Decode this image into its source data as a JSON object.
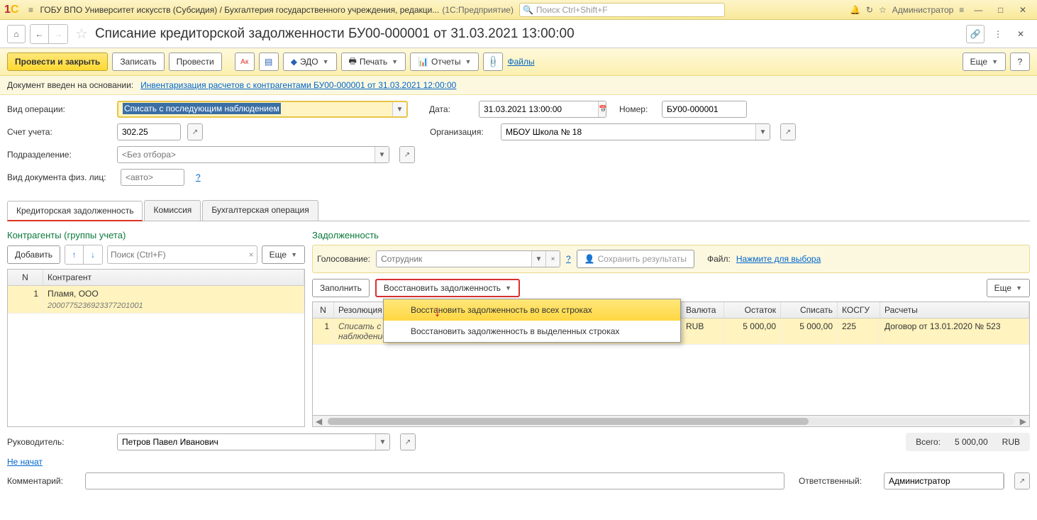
{
  "titlebar": {
    "text": "ГОБУ ВПО Университет искусств (Субсидия) / Бухгалтерия государственного учреждения, редакци...",
    "app": "(1С:Предприятие)",
    "search_placeholder": "Поиск Ctrl+Shift+F",
    "user": "Администратор"
  },
  "header": {
    "title": "Списание кредиторской задолженности БУ00-000001 от 31.03.2021 13:00:00"
  },
  "toolbar": {
    "provesti_zakryt": "Провести и закрыть",
    "zapisat": "Записать",
    "provesti": "Провести",
    "edo": "ЭДО",
    "pechat": "Печать",
    "otchety": "Отчеты",
    "files": "Файлы",
    "more": "Еще"
  },
  "info": {
    "prefix": "Документ введен на основании:",
    "link": "Инвентаризация расчетов с контрагентами БУ00-000001 от 31.03.2021 12:00:00"
  },
  "form": {
    "vid_operacii_label": "Вид операции:",
    "vid_operacii_value": "Списать с последующим наблюдением",
    "data_label": "Дата:",
    "data_value": "31.03.2021 13:00:00",
    "nomer_label": "Номер:",
    "nomer_value": "БУ00-000001",
    "schet_label": "Счет учета:",
    "schet_value": "302.25",
    "org_label": "Организация:",
    "org_value": "МБОУ Школа № 18",
    "podrazd_label": "Подразделение:",
    "podrazd_placeholder": "<Без отбора>",
    "viddoc_label": "Вид документа физ. лиц:",
    "viddoc_placeholder": "<авто>"
  },
  "tabs": {
    "t1": "Кредиторская задолженность",
    "t2": "Комиссия",
    "t3": "Бухгалтерская операция"
  },
  "left_panel": {
    "title": "Контрагенты (группы учета)",
    "add": "Добавить",
    "search_placeholder": "Поиск (Ctrl+F)",
    "more": "Еще",
    "col_n": "N",
    "col_contr": "Контрагент",
    "row_n": "1",
    "row_name": "Пламя, ООО",
    "row_code": "2000775236923377201001"
  },
  "right_panel": {
    "title": "Задолженность",
    "golos_label": "Голосование:",
    "golos_placeholder": "Сотрудник",
    "save_results": "Сохранить результаты",
    "file_label": "Файл:",
    "file_link": "Нажмите для выбора",
    "zapolnit": "Заполнить",
    "restore": "Восстановить задолженность",
    "more": "Еще",
    "menu1": "Восстановить задолженность во всех строках",
    "menu2": "Восстановить задолженность в выделенных строках",
    "cols": {
      "n": "N",
      "rez": "Резолюция",
      "valuta": "Валюта",
      "ostatok": "Остаток",
      "spisat": "Списать",
      "kosgu": "КОСГУ",
      "raschety": "Расчеты"
    },
    "row": {
      "n": "1",
      "rez": "Списать с последующим наблюдением",
      "valuta": "RUB",
      "ostatok": "5 000,00",
      "spisat": "5 000,00",
      "kosgu": "225",
      "raschety": "Договор от 13.01.2020 № 523"
    }
  },
  "bottom": {
    "ruk_label": "Руководитель:",
    "ruk_value": "Петров Павел Иванович",
    "total_label": "Всего:",
    "total_value": "5 000,00",
    "total_cur": "RUB",
    "ne_nachat": "Не начат",
    "comment_label": "Комментарий:",
    "otv_label": "Ответственный:",
    "otv_value": "Администратор"
  }
}
